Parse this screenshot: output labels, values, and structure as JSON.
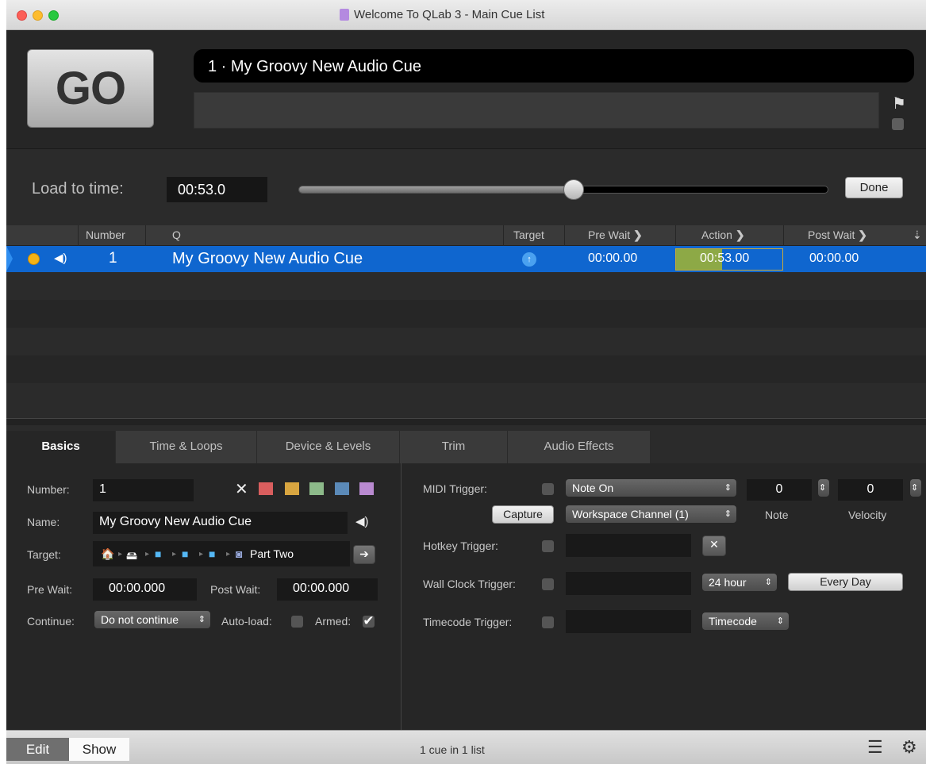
{
  "window": {
    "title": "Welcome To QLab 3 - Main Cue List"
  },
  "top": {
    "go_label": "GO",
    "standby_cue": "1 · My Groovy New Audio Cue",
    "notes": ""
  },
  "load": {
    "label": "Load to time:",
    "time": "00:53.0",
    "progress": 0.52,
    "done_label": "Done"
  },
  "list": {
    "headers": {
      "number": "Number",
      "q": "Q",
      "target": "Target",
      "pre_wait": "Pre Wait",
      "action": "Action",
      "post_wait": "Post Wait"
    },
    "rows": [
      {
        "number": "1",
        "name": "My Groovy New Audio Cue",
        "pre_wait": "00:00.00",
        "action": "00:53.00",
        "action_progress": 0.43,
        "post_wait": "00:00.00"
      }
    ]
  },
  "tabs": [
    "Basics",
    "Time & Loops",
    "Device & Levels",
    "Trim",
    "Audio Effects"
  ],
  "basics": {
    "number_label": "Number:",
    "number": "1",
    "name_label": "Name:",
    "name": "My Groovy New Audio Cue",
    "target_label": "Target:",
    "target_file": "Part Two",
    "pre_wait_label": "Pre Wait:",
    "pre_wait": "00:00.000",
    "post_wait_label": "Post Wait:",
    "post_wait": "00:00.000",
    "continue_label": "Continue:",
    "continue_value": "Do not continue",
    "autoload_label": "Auto-load:",
    "armed_label": "Armed:",
    "colors": [
      "#d95e5e",
      "#d8a540",
      "#8dba8a",
      "#5b8ab8",
      "#b98ad0"
    ]
  },
  "triggers": {
    "midi_label": "MIDI Trigger:",
    "midi_type": "Note On",
    "note_value": "0",
    "velocity_value": "0",
    "capture_label": "Capture",
    "channel": "Workspace Channel (1)",
    "note_label": "Note",
    "velocity_label": "Velocity",
    "hotkey_label": "Hotkey Trigger:",
    "wallclock_label": "Wall Clock Trigger:",
    "clock_format": "24 hour",
    "every_day_label": "Every Day",
    "timecode_label": "Timecode Trigger:",
    "timecode_value": "Timecode"
  },
  "bottom": {
    "edit_label": "Edit",
    "show_label": "Show",
    "status": "1 cue in 1 list"
  }
}
